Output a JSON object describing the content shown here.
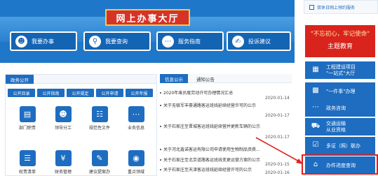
{
  "hall": {
    "title": "网上办事大厅",
    "buttons": [
      {
        "label": "我要办事",
        "icon": "person-icon"
      },
      {
        "label": "我要查询",
        "icon": "search-icon"
      },
      {
        "label": "服务指南",
        "icon": "chat-icon"
      },
      {
        "label": "投诉建议",
        "icon": "complaint-icon"
      }
    ]
  },
  "gov": {
    "tab": "政务公开",
    "subtabs": [
      "公开目录",
      "公开指南",
      "公开规定",
      "公开申请",
      "公开年报"
    ],
    "tiles": [
      {
        "label": "部门职责",
        "icon": "document-icon"
      },
      {
        "label": "领导分工",
        "icon": "person-icon"
      },
      {
        "label": "规范性文件",
        "icon": "file-icon"
      },
      {
        "label": "业务信息",
        "icon": "message-icon"
      },
      {
        "label": "权责清单",
        "icon": "list-icon"
      },
      {
        "label": "财务管理",
        "icon": "yen-icon"
      },
      {
        "label": "建议提案办",
        "icon": "proposal-icon"
      },
      {
        "label": "重点领域",
        "icon": "focus-icon"
      }
    ]
  },
  "news": {
    "tab_active": "信息公示",
    "tab_other": "通知公告",
    "items": [
      {
        "title": "2020年乘员度劳动许可办理情况汇总",
        "date": "2020-01-14"
      },
      {
        "title": "关于无极军丰豪通路客运班线延续经营许可的公示",
        "date": ""
      },
      {
        "title": "",
        "date": "2020-01-17"
      },
      {
        "title": "关于石家庄至晋城客运班线延续营并更新车辆的公示",
        "date": ""
      },
      {
        "title": "",
        "date": "2020-01-17"
      },
      {
        "title": "关于河北鑫诺客运有限公司申请使用生物制品资质...",
        "date": ""
      },
      {
        "title": "关于石家庄至北京道路客运班线变更运营方案的公示",
        "date": "2020-01-15"
      },
      {
        "title": "关于石家庄至天津客运班线延续经营许可的公示",
        "date": "2020-01-16"
      }
    ]
  },
  "side": {
    "top_link": "双休日网上预约服务",
    "red_banner": {
      "line1": "\"不忘初心，牢记使命\"",
      "line2": "主题教育"
    },
    "items": [
      {
        "label": "工程建设项目\n\"一站式\"大厅",
        "icon": "building-icon"
      },
      {
        "label": "\"一件事\"办理",
        "icon": "briefcase-icon"
      },
      {
        "label": "政务咨询",
        "icon": "chat-icon"
      },
      {
        "label": "交通运输\n从业资格",
        "icon": "truck-icon"
      },
      {
        "label": "多证（照）联办",
        "icon": "certificate-icon"
      },
      {
        "label": "办件进度查询",
        "icon": "progress-icon"
      }
    ]
  }
}
